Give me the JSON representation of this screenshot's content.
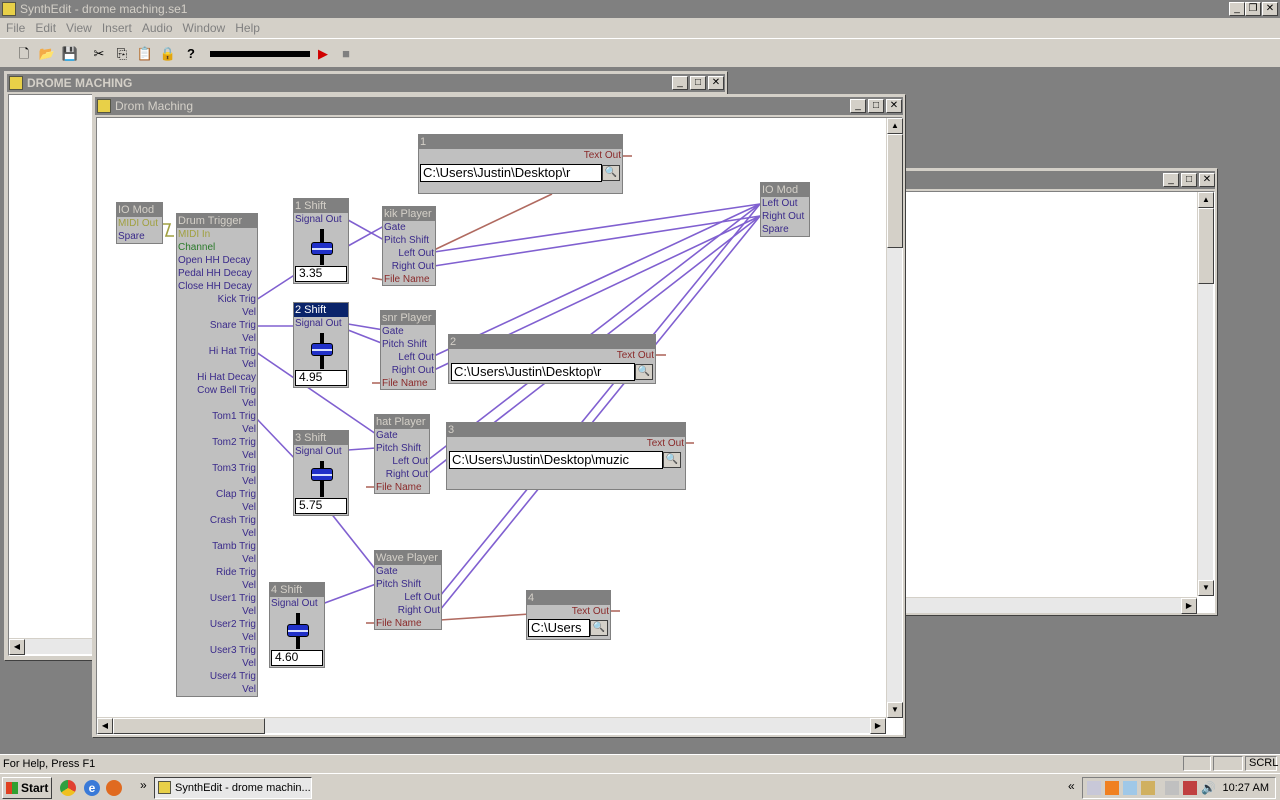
{
  "app": {
    "title": "SynthEdit - drome maching.se1"
  },
  "menu": [
    "File",
    "Edit",
    "View",
    "Insert",
    "Audio",
    "Window",
    "Help"
  ],
  "toolbar": {
    "help": "?"
  },
  "windows": {
    "outer": {
      "title": "DROME MACHING"
    },
    "inner": {
      "title": "Drom Maching"
    }
  },
  "modules": {
    "io_in": {
      "title": "IO Mod",
      "pins": [
        "MIDI Out",
        "Spare"
      ]
    },
    "drum_trigger": {
      "title": "Drum Trigger",
      "pins_left": [
        "MIDI In",
        "Channel",
        "Open HH Decay",
        "Pedal HH Decay",
        "Close HH Decay"
      ],
      "pins_right": [
        "Kick Trig",
        "Vel",
        "Snare Trig",
        "Vel",
        "Hi Hat Trig",
        "Vel",
        "Hi Hat Decay",
        "Cow Bell Trig",
        "Vel",
        "Tom1 Trig",
        "Vel",
        "Tom2 Trig",
        "Vel",
        "Tom3 Trig",
        "Vel",
        "Clap Trig",
        "Vel",
        "Crash Trig",
        "Vel",
        "Tamb Trig",
        "Vel",
        "Ride Trig",
        "Vel",
        "User1 Trig",
        "Vel",
        "User2 Trig",
        "Vel",
        "User3 Trig",
        "Vel",
        "User4 Trig",
        "Vel"
      ]
    },
    "shift1": {
      "title": "1 Shift",
      "out": "Signal Out",
      "value": "3.35",
      "level": 0.5
    },
    "shift2": {
      "title": "2 Shift",
      "out": "Signal Out",
      "value": "4.95",
      "level": 0.5
    },
    "shift3": {
      "title": "3 Shift",
      "out": "Signal Out",
      "value": "5.75",
      "level": 0.5
    },
    "shift4": {
      "title": "4 Shift",
      "out": "Signal Out",
      "value": "4.60",
      "level": 0.5
    },
    "kik": {
      "title": "kik Player",
      "pins": [
        "Gate",
        "Pitch Shift",
        "Left Out",
        "Right Out",
        "File Name"
      ]
    },
    "snr": {
      "title": "snr Player",
      "pins": [
        "Gate",
        "Pitch Shift",
        "Left Out",
        "Right Out",
        "File Name"
      ]
    },
    "hat": {
      "title": "hat Player",
      "pins": [
        "Gate",
        "Pitch Shift",
        "Left Out",
        "Right Out",
        "File Name"
      ]
    },
    "wave": {
      "title": "Wave Player",
      "pins": [
        "Gate",
        "Pitch Shift",
        "Left Out",
        "Right Out",
        "File Name"
      ]
    },
    "file1": {
      "title": "1",
      "out": "Text Out",
      "path": "C:\\Users\\Justin\\Desktop\\r"
    },
    "file2": {
      "title": "2",
      "out": "Text Out",
      "path": "C:\\Users\\Justin\\Desktop\\r"
    },
    "file3": {
      "title": "3",
      "out": "Text Out",
      "path": "C:\\Users\\Justin\\Desktop\\muzic"
    },
    "file4": {
      "title": "4",
      "out": "Text Out",
      "path": "C:\\Users"
    },
    "io_out": {
      "title": "IO Mod",
      "pins": [
        "Left Out",
        "Right Out",
        "Spare"
      ]
    }
  },
  "status": {
    "help": "For Help, Press F1",
    "scrl": "SCRL"
  },
  "taskbar": {
    "start": "Start",
    "task": "SynthEdit - drome machin...",
    "chevron": "»",
    "tray_chevron": "«",
    "clock": "10:27 AM"
  },
  "colors": {
    "wire_signal": "#8060d0",
    "wire_text": "#b06a60",
    "wire_midi": "#a0a040",
    "module_header": "#808080",
    "selected_header": "#0a246a"
  }
}
